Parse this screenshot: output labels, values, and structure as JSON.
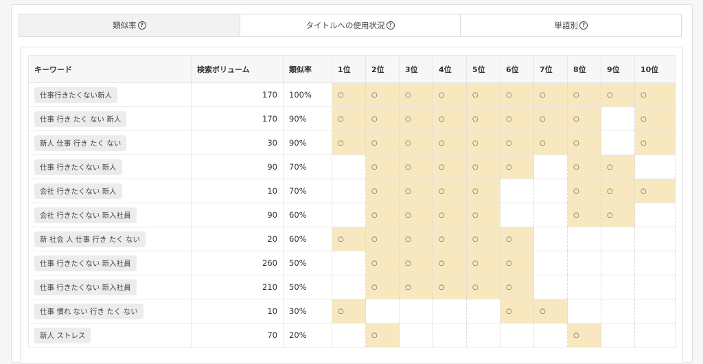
{
  "tabs": [
    {
      "label": "類似率",
      "active": true
    },
    {
      "label": "タイトルへの使用状況",
      "active": false
    },
    {
      "label": "単語別",
      "active": false
    }
  ],
  "help_glyph": "?",
  "table": {
    "headers": {
      "keyword": "キーワード",
      "volume": "検索ボリューム",
      "similarity": "類似率",
      "ranks": [
        "1位",
        "2位",
        "3位",
        "4位",
        "5位",
        "6位",
        "7位",
        "8位",
        "9位",
        "10位"
      ]
    },
    "mark": "○",
    "highlight_color": "#f8e8c0",
    "rows": [
      {
        "keyword": "仕事行きたくない新人",
        "volume": "170",
        "similarity": "100%",
        "ranks": [
          1,
          1,
          1,
          1,
          1,
          1,
          1,
          1,
          1,
          1
        ]
      },
      {
        "keyword": "仕事 行き たく ない 新人",
        "volume": "170",
        "similarity": "90%",
        "ranks": [
          1,
          1,
          1,
          1,
          1,
          1,
          1,
          1,
          0,
          1
        ]
      },
      {
        "keyword": "新人 仕事 行き たく ない",
        "volume": "30",
        "similarity": "90%",
        "ranks": [
          1,
          1,
          1,
          1,
          1,
          1,
          1,
          1,
          0,
          1
        ]
      },
      {
        "keyword": "仕事 行きたくない 新人",
        "volume": "90",
        "similarity": "70%",
        "ranks": [
          0,
          1,
          1,
          1,
          1,
          1,
          0,
          1,
          1,
          0
        ]
      },
      {
        "keyword": "会社 行きたくない 新人",
        "volume": "10",
        "similarity": "70%",
        "ranks": [
          0,
          1,
          1,
          1,
          1,
          0,
          0,
          1,
          1,
          1
        ]
      },
      {
        "keyword": "会社 行きたくない 新入社員",
        "volume": "90",
        "similarity": "60%",
        "ranks": [
          0,
          1,
          1,
          1,
          1,
          0,
          0,
          1,
          1,
          0
        ]
      },
      {
        "keyword": "新 社会 人 仕事 行き たく ない",
        "volume": "20",
        "similarity": "60%",
        "ranks": [
          1,
          1,
          1,
          1,
          1,
          1,
          0,
          0,
          0,
          0
        ]
      },
      {
        "keyword": "仕事 行きたくない 新入社員",
        "volume": "260",
        "similarity": "50%",
        "ranks": [
          0,
          1,
          1,
          1,
          1,
          1,
          0,
          0,
          0,
          0
        ]
      },
      {
        "keyword": "仕事 行きたくない 新入社員",
        "volume": "210",
        "similarity": "50%",
        "ranks": [
          0,
          1,
          1,
          1,
          1,
          1,
          0,
          0,
          0,
          0
        ]
      },
      {
        "keyword": "仕事 慣れ ない 行き たく ない",
        "volume": "10",
        "similarity": "30%",
        "ranks": [
          1,
          0,
          0,
          0,
          0,
          1,
          1,
          0,
          0,
          0
        ]
      },
      {
        "keyword": "新人 ストレス",
        "volume": "70",
        "similarity": "20%",
        "ranks": [
          0,
          1,
          0,
          0,
          0,
          0,
          0,
          1,
          0,
          0
        ]
      }
    ]
  }
}
